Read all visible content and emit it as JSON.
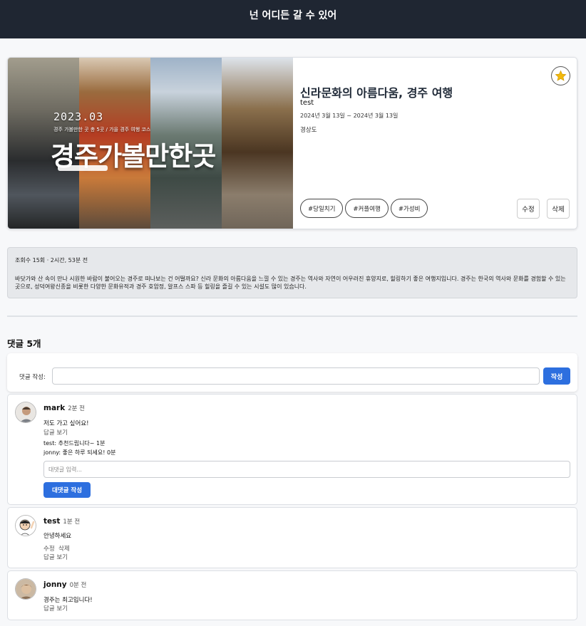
{
  "header": {
    "title": "넌 어디든 갈 수 있어"
  },
  "post": {
    "thumbnail": {
      "year": "2023.03",
      "subtitle": "경주 가볼만한 곳 총 5곳 / 가을 경주 여행 코스",
      "title": "경주가볼만한곳"
    },
    "title": "신라문화의 아름다움, 경주 여행",
    "author": "test",
    "dates": "2024년 3월 13일 ~ 2024년 3월 13일",
    "region": "경상도",
    "favorite_icon": "star-icon",
    "favorite_color": "#f2b90c",
    "tags": [
      "#당일치기",
      "#커플여행",
      "#가성비"
    ],
    "edit_label": "수정",
    "delete_label": "삭제"
  },
  "description": {
    "meta": "조회수 15회 · 2시간, 53분 전",
    "text": "바닷가와 산 속이 만나 시원한 바람이 불어오는 경주로 떠나보는 건 어떨까요? 신라 문화의 아름다움을 느낄 수 있는 경주는 역사와 자연이 어우러진 휴양지로, 힐링하기 좋은 여행지입니다. 경주는 한국의 역사와 문화를 경험할 수 있는 곳으로, 성덕여왕신종을 비롯한 다양한 문화유적과 경주 호암정, 알프스 스파 등 힐링을 즐길 수 있는 시설도 많이 있습니다."
  },
  "comments_section": {
    "title": "댓글 5개",
    "write_label": "댓글 작성:",
    "submit_label": "작성",
    "accent_color": "#2d6fdf"
  },
  "comments": [
    {
      "name": "mark",
      "time": "2분 전",
      "text": "저도 가고 싶어요!",
      "reply_link": "답글 보기",
      "replies": [
        {
          "author": "test",
          "text": "추천드립니다~",
          "time": "1분"
        },
        {
          "author": "jonny",
          "text": "좋은 하루 되세요!",
          "time": "0분"
        }
      ],
      "reply_placeholder": "대댓글 입력...",
      "reply_submit": "대댓글 작성"
    },
    {
      "name": "test",
      "time": "1분 전",
      "text": "안녕하세요",
      "edit": "수정",
      "delete": "삭제",
      "reply_link": "답글 보기"
    },
    {
      "name": "jonny",
      "time": "0분 전",
      "text": "경주는 최고입니다!",
      "reply_link": "답글 보기"
    }
  ]
}
